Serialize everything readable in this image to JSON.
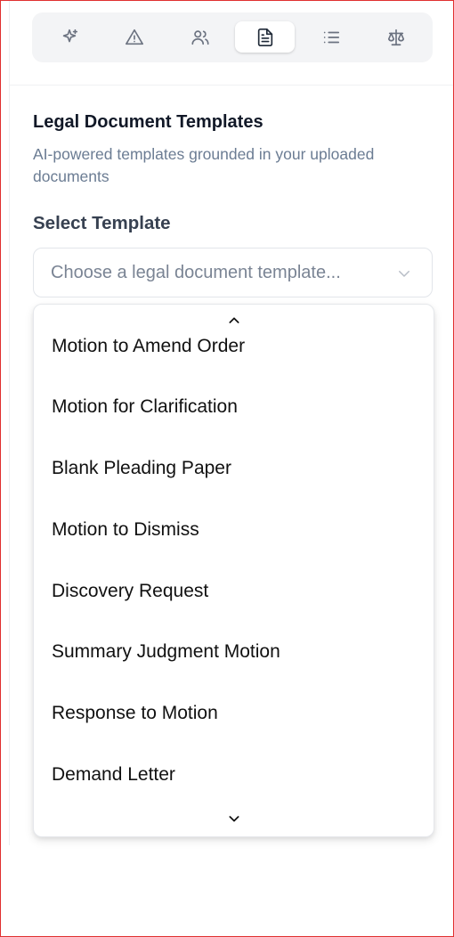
{
  "tabs": [
    {
      "icon": "sparkles-icon",
      "active": false
    },
    {
      "icon": "warning-triangle-icon",
      "active": false
    },
    {
      "icon": "users-icon",
      "active": false
    },
    {
      "icon": "document-icon",
      "active": true
    },
    {
      "icon": "list-icon",
      "active": false
    },
    {
      "icon": "scale-icon",
      "active": false
    }
  ],
  "panel": {
    "title": "Legal Document Templates",
    "subtitle": "AI-powered templates grounded in your uploaded documents",
    "select_label": "Select Template"
  },
  "select": {
    "placeholder": "Choose a legal document template..."
  },
  "dropdown": {
    "options": [
      "Motion to Amend Order",
      "Motion for Clarification",
      "Blank Pleading Paper",
      "Motion to Dismiss",
      "Discovery Request",
      "Summary Judgment Motion",
      "Response to Motion",
      "Demand Letter"
    ]
  },
  "colors": {
    "tabbar_bg": "#f3f4f6",
    "title": "#111827",
    "subtitle": "#6b7c93",
    "border": "#e2e5ea",
    "window_frame": "#e03030"
  }
}
